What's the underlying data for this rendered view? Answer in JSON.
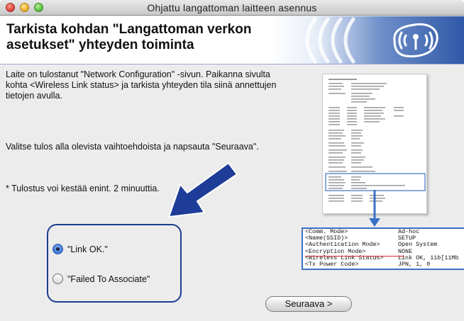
{
  "window": {
    "title": "Ohjattu langattoman laitteen asennus"
  },
  "header": {
    "title": "Tarkista kohdan \"Langattoman verkon asetukset\" yhteyden toiminta"
  },
  "content": {
    "paragraph1": "Laite on tulostanut \"Network Configuration\" -sivun. Paikanna sivulta kohta <Wireless Link status> ja tarkista yhteyden tila siinä annettujen tietojen avulla.",
    "paragraph2": "Valitse tulos alla olevista vaihtoehdoista ja napsauta \"Seuraava\".",
    "note": "* Tulostus voi kestää enint. 2 minuuttia."
  },
  "options": [
    {
      "label": "\"Link OK.\"",
      "selected": true
    },
    {
      "label": "\"Failed To Associate\"",
      "selected": false
    }
  ],
  "callout": {
    "rows": [
      {
        "key": "<Comm. Mode>",
        "value": "Ad-hoc"
      },
      {
        "key": "<Name(SSID)>",
        "value": "SETUP"
      },
      {
        "key": "<Authentication Mode>",
        "value": "Open System"
      },
      {
        "key": "<Encryption Mode>",
        "value": "NONE"
      },
      {
        "key": "<Wireless Link Status>",
        "value": "Link OK, 11b[11Mb"
      },
      {
        "key": "<Tx Power Code>",
        "value": "JPN, 1, 0"
      }
    ]
  },
  "buttons": {
    "next": "Seuraava >"
  },
  "colors": {
    "accent_blue": "#1d3c8f",
    "callout_border": "#3b70c4",
    "highlight_red": "#d62a2a"
  },
  "icons": {
    "header_logo": "wireless-signal-icon",
    "pointer": "arrow-icon"
  }
}
